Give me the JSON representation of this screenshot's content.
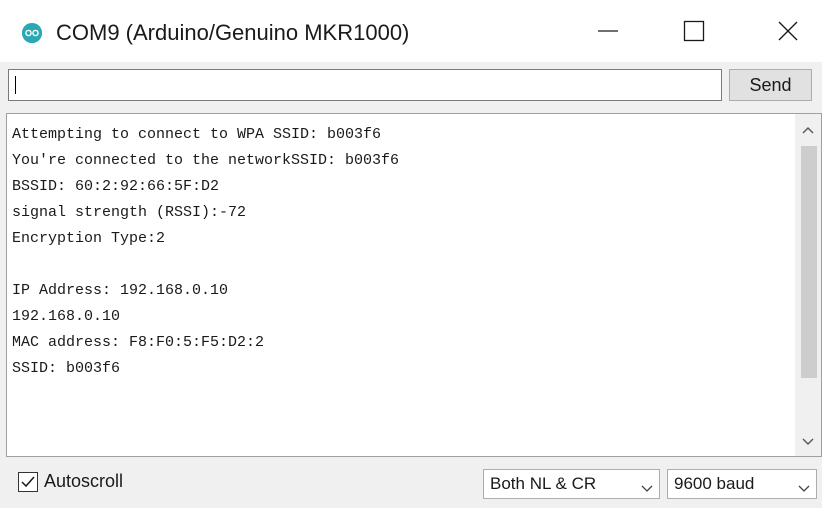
{
  "window": {
    "title": "COM9 (Arduino/Genuino MKR1000)"
  },
  "input": {
    "value": "",
    "send_label": "Send"
  },
  "output": {
    "lines": [
      "Attempting to connect to WPA SSID: b003f6",
      "You're connected to the networkSSID: b003f6",
      "BSSID: 60:2:92:66:5F:D2",
      "signal strength (RSSI):-72",
      "Encryption Type:2",
      "",
      "IP Address: 192.168.0.10",
      "192.168.0.10",
      "MAC address: F8:F0:5:F5:D2:2",
      "SSID: b003f6"
    ]
  },
  "footer": {
    "autoscroll_label": "Autoscroll",
    "autoscroll_checked": true,
    "line_ending": "Both NL & CR",
    "baud_rate": "9600 baud"
  },
  "icons": {
    "app": "arduino-icon",
    "minimize": "minimize-icon",
    "maximize": "maximize-icon",
    "close": "close-icon",
    "scroll_up": "chevron-up-icon",
    "scroll_down": "chevron-down-icon",
    "checkbox": "checkmark-icon"
  },
  "colors": {
    "app_icon": "#2aa9b4",
    "window_bg": "#f0f0f0",
    "output_bg": "#ffffff"
  }
}
